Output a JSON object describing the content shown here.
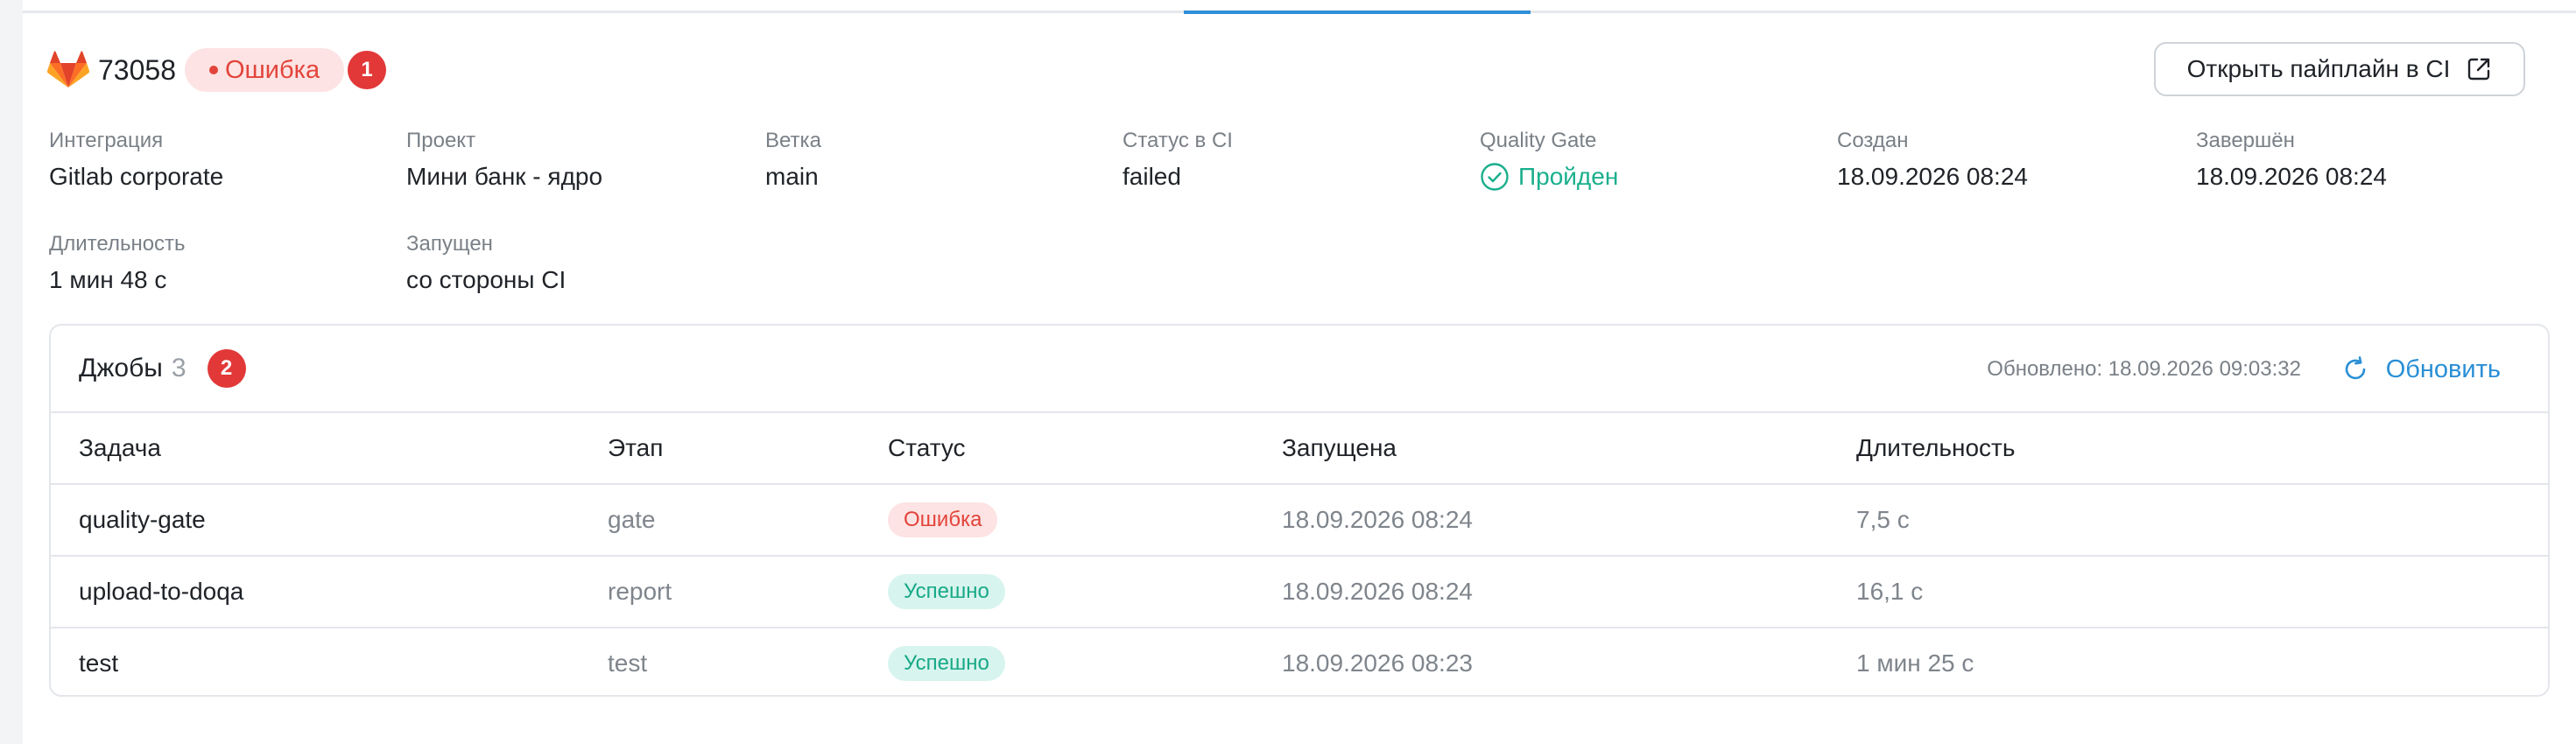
{
  "pipeline": {
    "id": "73058",
    "status_label": "Ошибка",
    "callout_1": "1",
    "open_button_label": "Открыть пайплайн в CI"
  },
  "fields": {
    "integration": {
      "label": "Интеграция",
      "value": "Gitlab corporate"
    },
    "project": {
      "label": "Проект",
      "value": "Мини банк - ядро"
    },
    "branch": {
      "label": "Ветка",
      "value": "main"
    },
    "ci_status": {
      "label": "Статус в CI",
      "value": "failed"
    },
    "quality_gate": {
      "label": "Quality Gate",
      "value": "Пройден"
    },
    "created": {
      "label": "Создан",
      "value": "18.09.2026 08:24"
    },
    "finished": {
      "label": "Завершён",
      "value": "18.09.2026 08:24"
    },
    "duration": {
      "label": "Длительность",
      "value": "1 мин 48 с"
    },
    "started_by": {
      "label": "Запущен",
      "value": "со стороны CI"
    }
  },
  "jobs": {
    "title": "Джобы",
    "count": "3",
    "callout_2": "2",
    "updated_text": "Обновлено: 18.09.2026 09:03:32",
    "refresh_label": "Обновить",
    "columns": [
      "Задача",
      "Этап",
      "Статус",
      "Запущена",
      "Длительность"
    ],
    "rows": [
      {
        "task": "quality-gate",
        "stage": "gate",
        "status": "Ошибка",
        "status_type": "error",
        "started": "18.09.2026 08:24",
        "duration": "7,5 с"
      },
      {
        "task": "upload-to-doqa",
        "stage": "report",
        "status": "Успешно",
        "status_type": "success",
        "started": "18.09.2026 08:24",
        "duration": "16,1 с"
      },
      {
        "task": "test",
        "stage": "test",
        "status": "Успешно",
        "status_type": "success",
        "started": "18.09.2026 08:23",
        "duration": "1 мин 25 с"
      }
    ]
  },
  "icons": {
    "logo": "gitlab-icon",
    "external_link": "external-link-icon",
    "quality_ok": "check-circle-icon",
    "refresh": "refresh-icon"
  },
  "colors": {
    "accent": "#2f8fd8",
    "error": "#e2443b",
    "success": "#1aaf8c",
    "callout": "#e23838"
  }
}
